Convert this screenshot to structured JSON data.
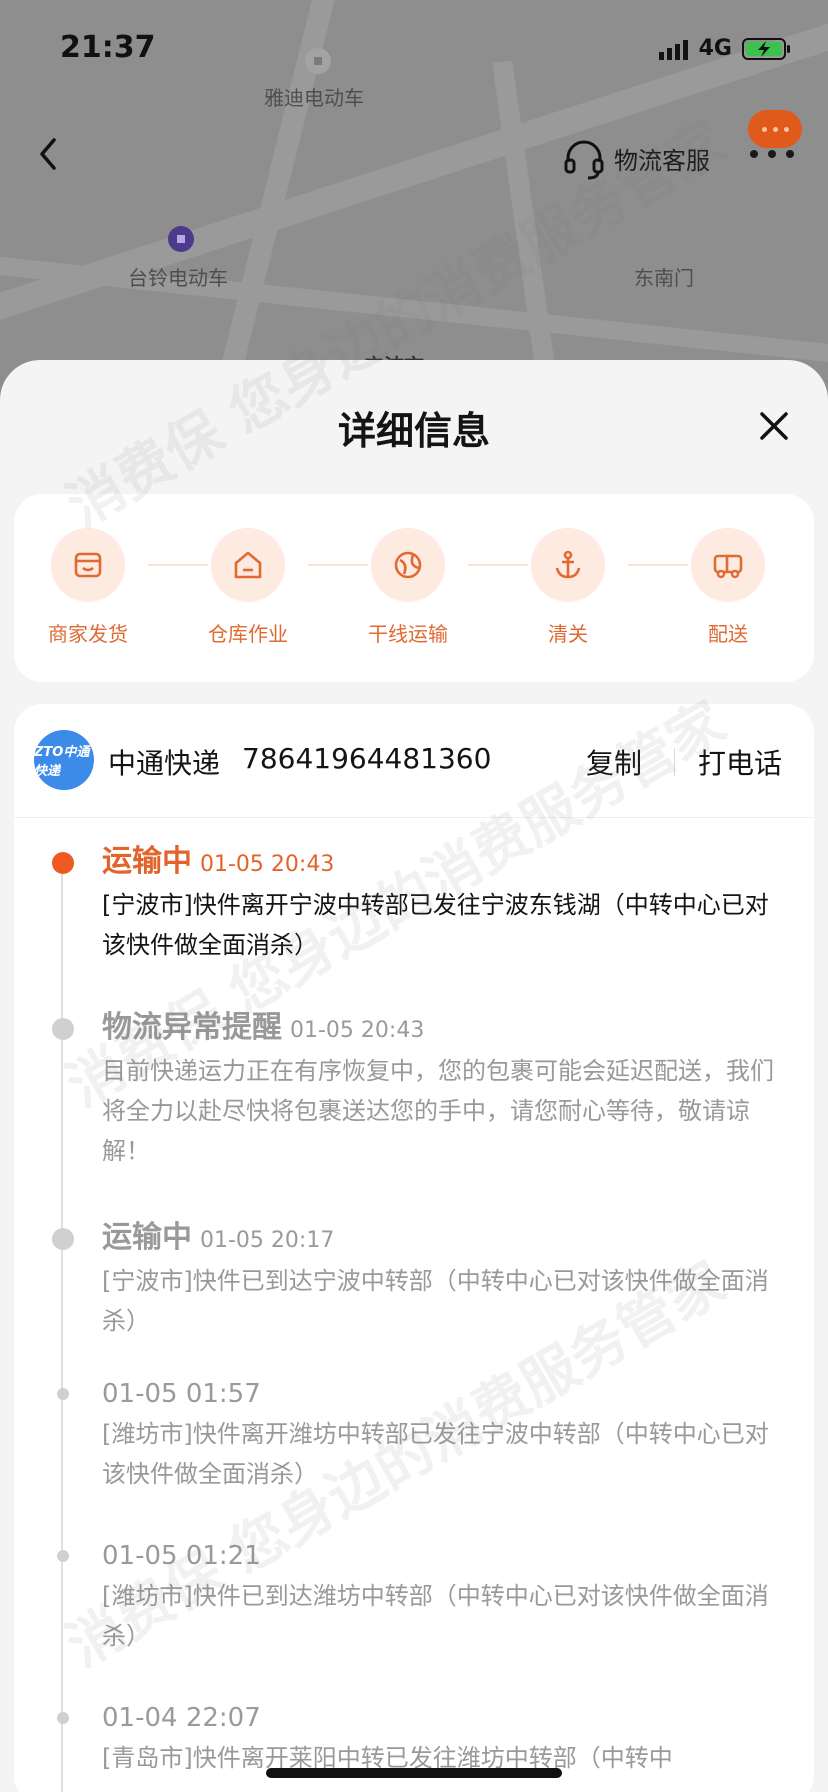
{
  "status": {
    "time": "21:37",
    "network": "4G"
  },
  "map": {
    "poi_1": "雅迪电动车",
    "poi_2": "台铃电动车",
    "poi_3": "东南门",
    "poi_4": "宁波市"
  },
  "topbar": {
    "service_label": "物流客服"
  },
  "sheet": {
    "title": "详细信息"
  },
  "steps": [
    {
      "label": "商家发货",
      "icon": "shop-icon"
    },
    {
      "label": "仓库作业",
      "icon": "warehouse-icon"
    },
    {
      "label": "干线运输",
      "icon": "transport-icon"
    },
    {
      "label": "清关",
      "icon": "anchor-icon"
    },
    {
      "label": "配送",
      "icon": "delivery-truck-icon"
    }
  ],
  "courier": {
    "logo_text": "ZTO中通快递",
    "name": "中通快递",
    "tracking_number": "78641964481360",
    "copy_label": "复制",
    "call_label": "打电话"
  },
  "events": [
    {
      "status": "运输中",
      "time": "01-05 20:43",
      "desc": "[宁波市]快件离开宁波中转部已发往宁波东钱湖（中转中心已对该快件做全面消杀）"
    },
    {
      "status": "物流异常提醒",
      "time": "01-05 20:43",
      "desc": "目前快递运力正在有序恢复中，您的包裹可能会延迟配送，我们将全力以赴尽快将包裹送达您的手中，请您耐心等待，敬请谅解！"
    },
    {
      "status": "运输中",
      "time": "01-05 20:17",
      "desc": "[宁波市]快件已到达宁波中转部（中转中心已对该快件做全面消杀）"
    },
    {
      "status": "",
      "time": "01-05 01:57",
      "desc": "[潍坊市]快件离开潍坊中转部已发往宁波中转部（中转中心已对该快件做全面消杀）"
    },
    {
      "status": "",
      "time": "01-05 01:21",
      "desc": "[潍坊市]快件已到达潍坊中转部（中转中心已对该快件做全面消杀）"
    },
    {
      "status": "",
      "time": "01-04 22:07",
      "desc": "[青岛市]快件离开莱阳中转已发往潍坊中转部（中转中"
    }
  ],
  "watermark": "消费保 您身边的消费服务管家",
  "colors": {
    "accent": "#E2642A",
    "accent_light": "#FDEAE0",
    "courier_blue": "#3D8BE8"
  }
}
